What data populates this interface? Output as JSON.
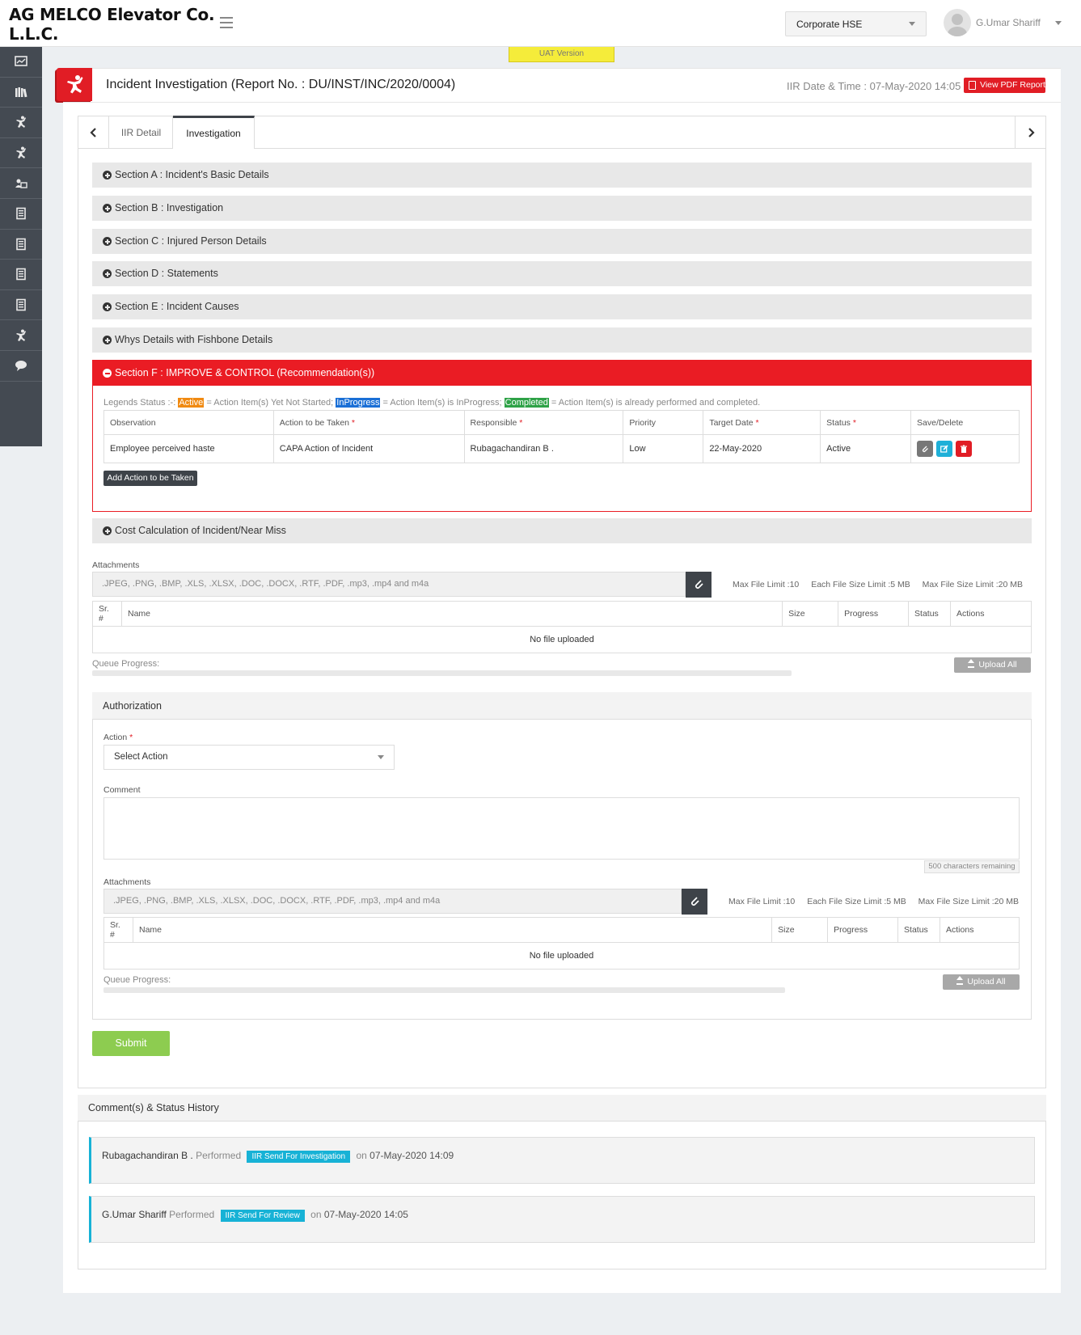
{
  "app": {
    "company_name": "AG MELCO Elevator Co. L.L.C.",
    "company_select": "Corporate HSE",
    "user_name": "G.Umar Shariff",
    "uat_badge": "UAT Version"
  },
  "header": {
    "title": "Incident Investigation (Report No. : DU/INST/INC/2020/0004)",
    "iir_datetime": "IIR Date & Time : 07-May-2020 14:05",
    "pdf_button": "View PDF Report"
  },
  "sidebar": {
    "icons": [
      "dashboard-icon",
      "library-icon",
      "incident-icon",
      "incident-icon",
      "id-card-icon",
      "document-icon",
      "document-icon",
      "document-icon",
      "document-icon",
      "incident-icon",
      "chat-icon"
    ]
  },
  "tabs": [
    {
      "label": "IIR Detail",
      "active": false
    },
    {
      "label": "Investigation",
      "active": true
    }
  ],
  "sections": [
    "Section A : Incident's Basic Details",
    "Section B : Investigation",
    "Section C : Injured Person Details",
    "Section D : Statements",
    "Section E : Incident Causes",
    "Whys Details with Fishbone Details"
  ],
  "section_f": {
    "title": "Section F : IMPROVE & CONTROL (Recommendation(s))",
    "legend": {
      "prefix": "Legends Status :-:",
      "active_tag": "Active",
      "active_text": "= Action Item(s) Yet Not Started;",
      "progress_tag": "InProgress",
      "progress_text": "= Action Item(s) is InProgress;",
      "done_tag": "Completed",
      "done_text": "= Action Item(s) is already performed and completed."
    },
    "columns": {
      "observation": "Observation",
      "action": "Action to be Taken",
      "responsible": "Responsible",
      "priority": "Priority",
      "target_date": "Target Date",
      "status": "Status",
      "save_delete": "Save/Delete"
    },
    "rows": [
      {
        "observation": "Employee perceived haste",
        "action": "CAPA Action of Incident",
        "responsible": "Rubagachandiran B .",
        "priority": "Low",
        "target_date": "22-May-2020",
        "status": "Active"
      }
    ],
    "add_button": "Add Action to be Taken"
  },
  "cost_section": "Cost Calculation of Incident/Near Miss",
  "attachments": {
    "label": "Attachments",
    "placeholder": ".JPEG, .PNG, .BMP, .XLS, .XLSX, .DOC, .DOCX, .RTF, .PDF, .mp3, .mp4 and m4a",
    "max_file_limit": "Max File Limit :10",
    "each_size_limit": "Each File Size Limit :5 MB",
    "max_size_limit": "Max File Size Limit :20 MB",
    "columns": {
      "sr": "Sr. #",
      "name": "Name",
      "size": "Size",
      "progress": "Progress",
      "status": "Status",
      "actions": "Actions"
    },
    "empty_text": "No file uploaded",
    "queue_label": "Queue Progress:",
    "upload_all": "Upload All"
  },
  "authorization": {
    "title": "Authorization",
    "action_label": "Action",
    "action_value": "Select Action",
    "comment_label": "Comment",
    "chars_remaining": "500 characters remaining"
  },
  "submit_button": "Submit",
  "history": {
    "title": "Comment(s) & Status History",
    "items": [
      {
        "who": "Rubagachandiran B .",
        "verb": "Performed",
        "badge": "IIR Send For Investigation",
        "on": "on",
        "when": "07-May-2020 14:09"
      },
      {
        "who": "G.Umar Shariff",
        "verb": "Performed",
        "badge": "IIR Send For Review",
        "on": "on",
        "when": "07-May-2020 14:05"
      }
    ]
  },
  "colors": {
    "accent_red": "#e11d25",
    "sidebar_bg": "#444a52",
    "submit_green": "#8dcc50",
    "history_cyan": "#17b2d6"
  }
}
